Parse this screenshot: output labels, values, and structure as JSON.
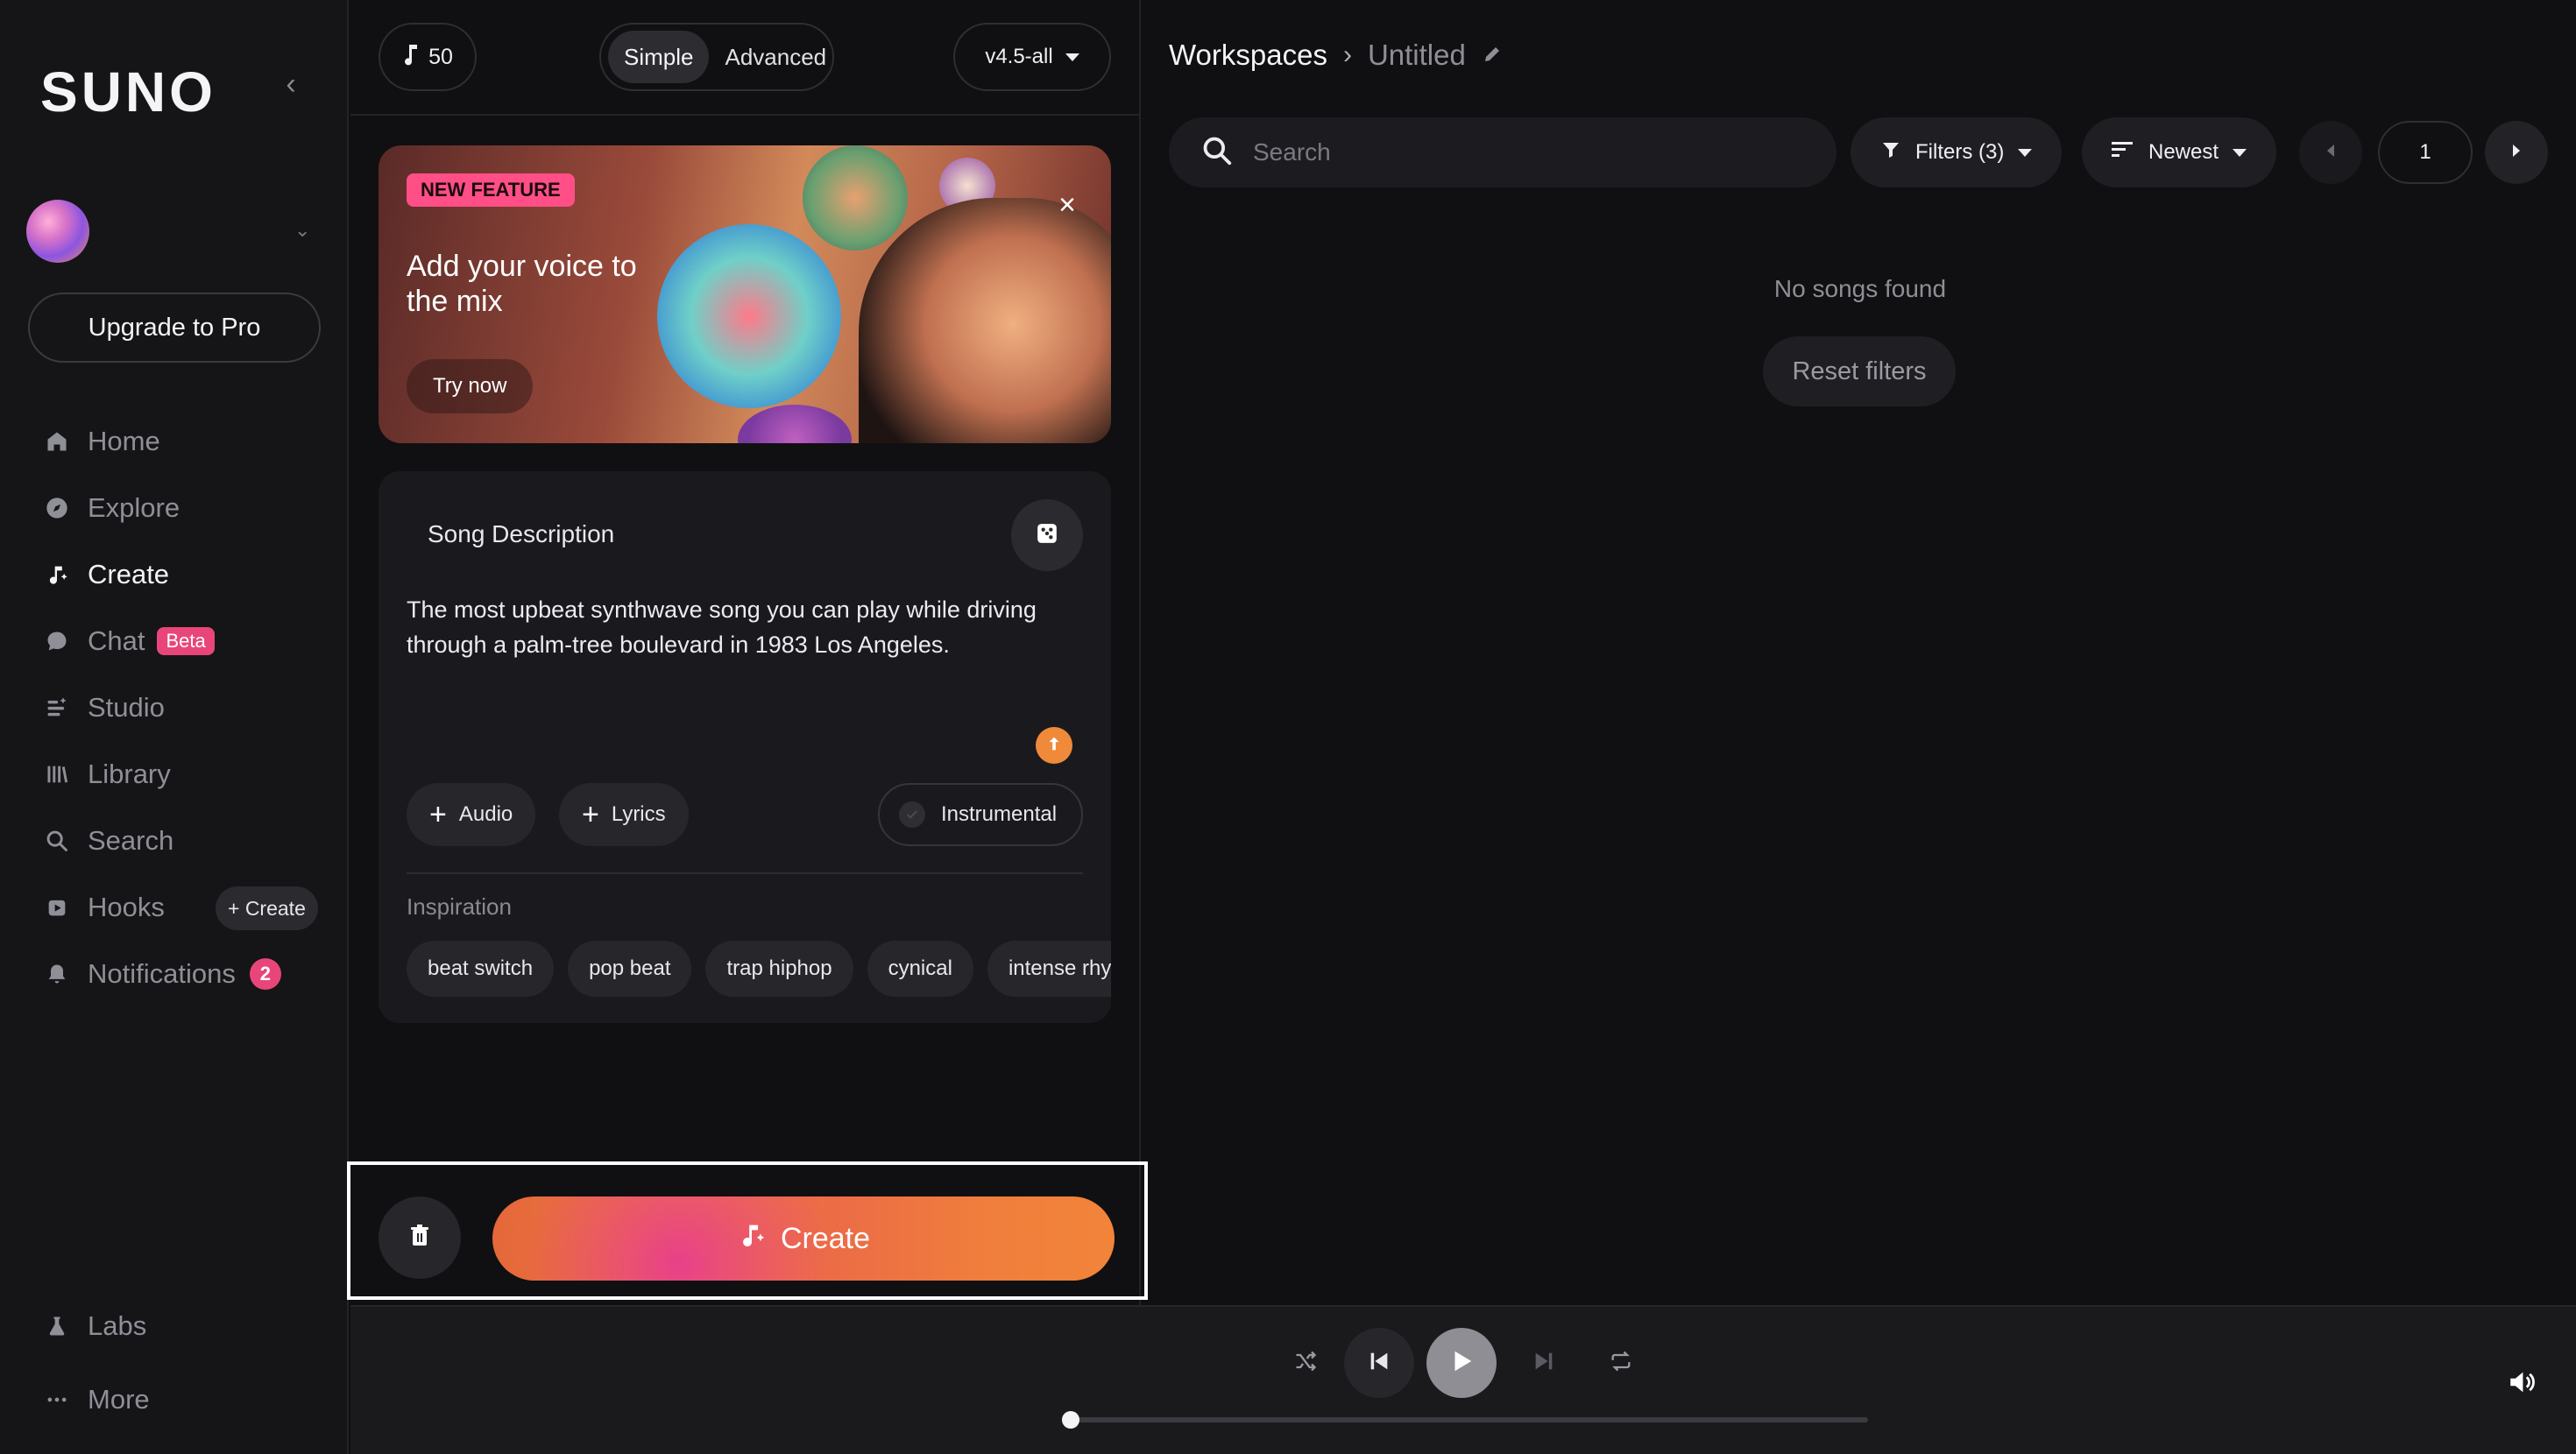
{
  "app": {
    "logo": "SUNO"
  },
  "sidebar": {
    "upgrade_label": "Upgrade to Pro",
    "items": [
      {
        "label": "Home",
        "icon": "home-icon",
        "active": false
      },
      {
        "label": "Explore",
        "icon": "compass-icon",
        "active": false
      },
      {
        "label": "Create",
        "icon": "music-sparkle-icon",
        "active": true
      },
      {
        "label": "Chat",
        "icon": "chat-icon",
        "active": false,
        "badge": "Beta"
      },
      {
        "label": "Studio",
        "icon": "studio-icon",
        "active": false
      },
      {
        "label": "Library",
        "icon": "library-icon",
        "active": false
      },
      {
        "label": "Search",
        "icon": "search-icon",
        "active": false
      },
      {
        "label": "Hooks",
        "icon": "hooks-icon",
        "active": false,
        "action": "+ Create"
      },
      {
        "label": "Notifications",
        "icon": "bell-icon",
        "active": false,
        "count": "2"
      }
    ],
    "bottom": [
      {
        "label": "Labs",
        "icon": "flask-icon"
      },
      {
        "label": "More",
        "icon": "more-icon"
      }
    ]
  },
  "create": {
    "credits": "50",
    "modes": [
      "Simple",
      "Advanced"
    ],
    "selected_mode": "Simple",
    "version": "v4.5-all",
    "promo": {
      "badge": "NEW FEATURE",
      "title": "Add your voice to the mix",
      "button": "Try now"
    },
    "description": {
      "label": "Song Description",
      "text": "The most upbeat synthwave song you can play while driving through a palm-tree boulevard in 1983 Los Angeles."
    },
    "audio_label": "Audio",
    "lyrics_label": "Lyrics",
    "instrumental_label": "Instrumental",
    "inspiration_label": "Inspiration",
    "tags": [
      "beat switch",
      "pop beat",
      "trap hiphop",
      "cynical",
      "intense rhyt"
    ],
    "create_label": "Create"
  },
  "workspace": {
    "breadcrumb_root": "Workspaces",
    "breadcrumb_current": "Untitled",
    "search_placeholder": "Search",
    "filters_label": "Filters (3)",
    "sort_label": "Newest",
    "page": "1",
    "empty_text": "No songs found",
    "reset_label": "Reset filters"
  },
  "colors": {
    "accent_orange": "#ef8a3a",
    "badge_pink": "#e8467a",
    "background": "#101012"
  }
}
